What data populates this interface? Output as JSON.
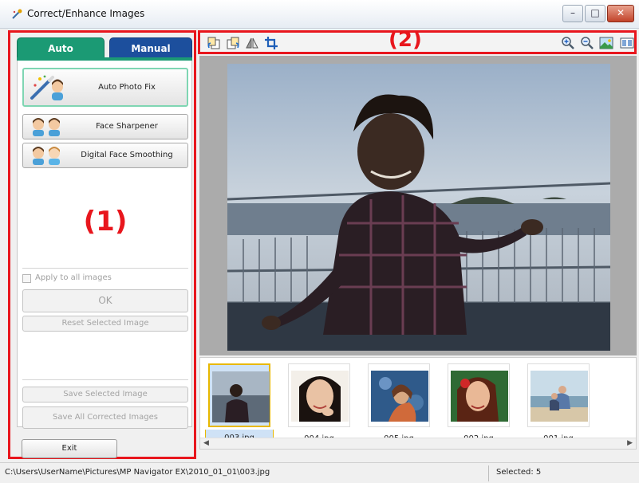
{
  "window": {
    "title": "Correct/Enhance Images"
  },
  "left_panel": {
    "tabs": [
      {
        "label": "Auto",
        "color": "#1b9a74",
        "active": true
      },
      {
        "label": "Manual",
        "color": "#1c4f9d",
        "active": false
      }
    ],
    "buttons": {
      "auto_photo_fix": "Auto Photo Fix",
      "face_sharpener": "Face Sharpener",
      "digital_face_smoothing": "Digital Face Smoothing"
    },
    "area_label": "(1)",
    "apply_all_label": "Apply to all images",
    "ok_label": "OK",
    "reset_label": "Reset Selected Image",
    "save_selected_label": "Save Selected Image",
    "save_all_label": "Save All Corrected Images",
    "exit_label": "Exit"
  },
  "toolbar": {
    "area_label": "(2)",
    "icons": [
      "rotate-left-icon",
      "rotate-right-icon",
      "mirror-icon",
      "crop-icon",
      "zoom-in-icon",
      "zoom-out-icon",
      "whole-image-icon",
      "compare-icon"
    ]
  },
  "thumbnails": [
    {
      "name": "003.jpg",
      "selected": true
    },
    {
      "name": "004.jpg",
      "selected": false
    },
    {
      "name": "005.jpg",
      "selected": false
    },
    {
      "name": "002.jpg",
      "selected": false
    },
    {
      "name": "001.jpg",
      "selected": false
    }
  ],
  "status": {
    "path": "C:\\Users\\UserName\\Pictures\\MP Navigator EX\\2010_01_01\\003.jpg",
    "selected": "Selected: 5"
  },
  "colors": {
    "highlight_red": "#e8161d",
    "tab_auto": "#1b9a74",
    "tab_manual": "#1c4f9d"
  }
}
